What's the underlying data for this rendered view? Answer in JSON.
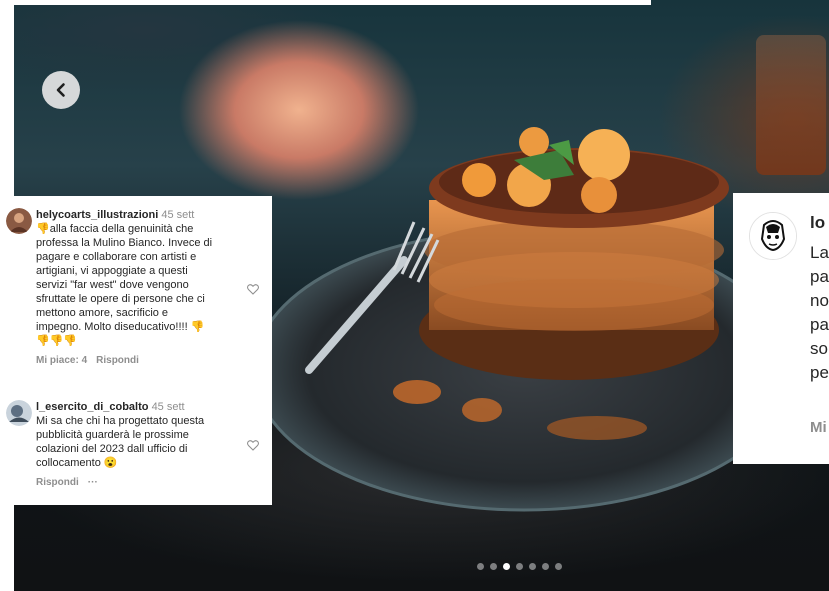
{
  "carousel": {
    "prev_icon": "chevron-left-icon",
    "dot_count": 7,
    "active_dot": 2
  },
  "comments": [
    {
      "username": "helycoarts_illustrazioni",
      "time": "45 sett",
      "avatar_icon": "user-avatar",
      "lines": [
        "👎alla faccia della genuinità che",
        "professa la Mulino Bianco. Invece di",
        "pagare e collaborare con artisti e",
        "artigiani, vi appoggiate a questi",
        "servizi \"far west\" dove vengono",
        "sfruttate le opere di persone che ci",
        "mettono amore, sacrificio e",
        "impegno. Molto diseducativo!!!! 👎",
        "👎👎👎"
      ],
      "likes_label": "Mi piace: 4",
      "reply_label": "Rispondi",
      "heart_icon": "heart-outline-icon"
    },
    {
      "username": "l_esercito_di_cobalto",
      "time": "45 sett",
      "avatar_icon": "user-avatar",
      "lines": [
        "Mi sa che chi ha progettato questa",
        "pubblicità guarderà le prossime",
        "colazioni del 2023 dall ufficio di",
        "collocamento 😮"
      ],
      "reply_label": "Rispondi",
      "more_label": "···",
      "heart_icon": "heart-outline-icon"
    }
  ],
  "right_comment": {
    "username_visible": "lo",
    "lines_visible": [
      "La",
      "pa",
      "no",
      "pa",
      "so",
      "pe"
    ],
    "meta_visible": "Mi"
  },
  "colors": {
    "text": "#262626",
    "muted": "#8e8e8e",
    "panel_bg": "#ffffff"
  }
}
